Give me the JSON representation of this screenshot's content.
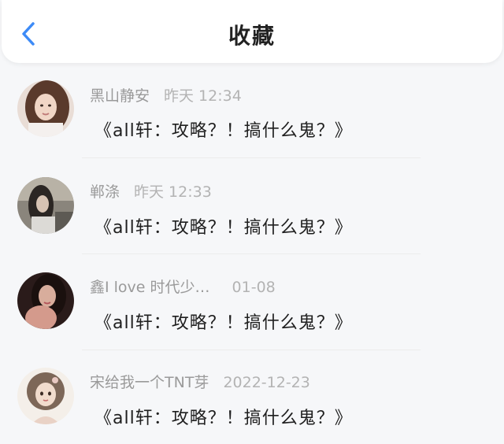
{
  "header": {
    "title": "收藏",
    "back_icon": "chevron-left-icon",
    "accent": "#3d8bf7"
  },
  "items": [
    {
      "author": "黑山静安",
      "time": "昨天 12:34",
      "title": "《all轩：攻略？！搞什么鬼？》",
      "avatar": "avatar-photo-icon"
    },
    {
      "author": "郸涤",
      "time": "昨天 12:33",
      "title": "《all轩：攻略？！搞什么鬼？》",
      "avatar": "avatar-photo-icon"
    },
    {
      "author": "鑫I love 时代少…",
      "time": "01-08",
      "title": "《all轩：攻略？！搞什么鬼？》",
      "avatar": "avatar-photo-icon"
    },
    {
      "author": "宋给我一个TNT芽",
      "time": "2022-12-23",
      "title": "《all轩：攻略？！搞什么鬼？》",
      "avatar": "avatar-illustration-icon"
    }
  ]
}
